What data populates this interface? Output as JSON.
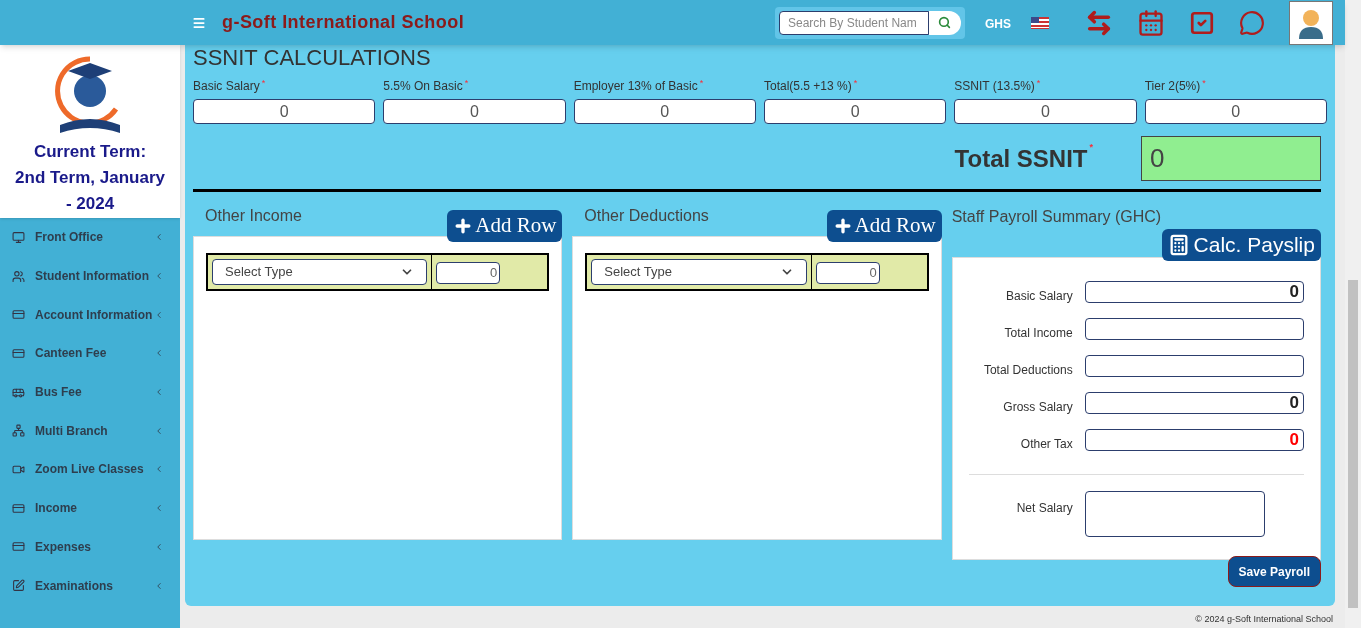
{
  "header": {
    "title": "g-Soft International School",
    "search": {
      "placeholder": "Search By Student Nam"
    },
    "currency": "GHS"
  },
  "sidebar": {
    "term_label": "Current Term:",
    "term": "2nd Term, January - 2024",
    "items": [
      {
        "label": "Front Office"
      },
      {
        "label": "Student Information"
      },
      {
        "label": "Account Information"
      },
      {
        "label": "Canteen Fee"
      },
      {
        "label": "Bus Fee"
      },
      {
        "label": "Multi Branch"
      },
      {
        "label": "Zoom Live Classes"
      },
      {
        "label": "Income"
      },
      {
        "label": "Expenses"
      },
      {
        "label": "Examinations"
      }
    ]
  },
  "ssnit": {
    "heading": "SSNIT CALCULATIONS",
    "fields": [
      {
        "label": "Basic Salary",
        "required_mark": "*",
        "value": "0"
      },
      {
        "label": "5.5% On Basic",
        "required_mark": "*",
        "value": "0"
      },
      {
        "label": "Employer 13% of Basic",
        "required_mark": "*",
        "value": "0"
      },
      {
        "label": "Total(5.5 +13 %)",
        "required_mark": "*",
        "value": "0"
      },
      {
        "label": "SSNIT (13.5%)",
        "required_mark": "*",
        "value": "0"
      },
      {
        "label": "Tier 2(5%)",
        "required_mark": "*",
        "value": "0"
      }
    ],
    "total": {
      "label": "Total SSNIT",
      "required_mark": "*",
      "value": "0"
    }
  },
  "other_income": {
    "title": "Other Income",
    "add_button": "Add Row",
    "rows": [
      {
        "type_placeholder": "Select Type",
        "amount": "0"
      }
    ]
  },
  "other_deductions": {
    "title": "Other Deductions",
    "add_button": "Add Row",
    "rows": [
      {
        "type_placeholder": "Select Type",
        "amount": "0"
      }
    ]
  },
  "payroll_summary": {
    "title": "Staff Payroll Summary (GHC)",
    "calc_button": "Calc. Payslip",
    "rows": [
      {
        "label": "Basic Salary",
        "value": "0",
        "color": "#222222"
      },
      {
        "label": "Total Income"
      },
      {
        "label": "Total Deductions"
      },
      {
        "label": "Gross Salary",
        "value": "0",
        "color": "#222222"
      },
      {
        "label": "Other Tax",
        "value": "0",
        "color": "#ff0000"
      }
    ],
    "net_salary": {
      "label": "Net Salary"
    },
    "save_button": "Save Payroll"
  },
  "footer": {
    "copyright": "© 2024 g-Soft International School"
  }
}
